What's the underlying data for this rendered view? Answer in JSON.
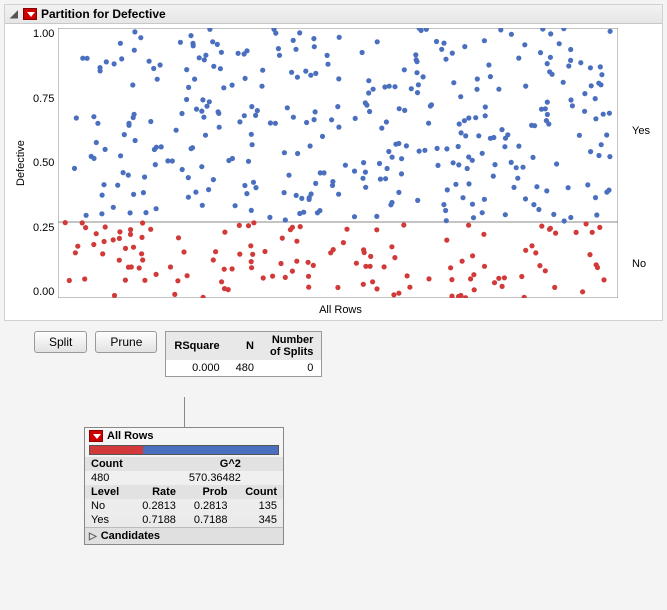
{
  "header": {
    "title": "Partition for Defective"
  },
  "chart": {
    "y_label": "Defective",
    "x_label": "All Rows",
    "y_ticks": [
      "1.00",
      "0.75",
      "0.50",
      "0.25",
      "0.00"
    ],
    "right_label_yes": "Yes",
    "right_label_no": "No"
  },
  "buttons": {
    "split": "Split",
    "prune": "Prune"
  },
  "stats": {
    "headers": {
      "rsquare": "RSquare",
      "n": "N",
      "splits": "Number\nof Splits"
    },
    "values": {
      "rsquare": "0.000",
      "n": "480",
      "splits": "0"
    }
  },
  "node": {
    "title": "All Rows",
    "summary": {
      "count_hdr": "Count",
      "g2_hdr": "G^2",
      "count": "480",
      "g2": "570.36482"
    },
    "levels": {
      "headers": {
        "level": "Level",
        "rate": "Rate",
        "prob": "Prob",
        "count": "Count"
      },
      "rows": [
        {
          "level": "No",
          "rate": "0.2813",
          "prob": "0.2813",
          "count": "135"
        },
        {
          "level": "Yes",
          "rate": "0.7188",
          "prob": "0.7188",
          "count": "345"
        }
      ]
    },
    "candidates_label": "Candidates"
  },
  "chart_data": {
    "type": "scatter",
    "title": "Partition for Defective",
    "xlabel": "All Rows",
    "ylabel": "Defective",
    "ylim": [
      0,
      1
    ],
    "split_y": 0.28,
    "series": [
      {
        "name": "Yes",
        "color": "#4a6fbf",
        "n": 345,
        "y_range": [
          0.28,
          1.0
        ]
      },
      {
        "name": "No",
        "color": "#d23a3a",
        "n": 135,
        "y_range": [
          0.0,
          0.28
        ]
      }
    ]
  }
}
